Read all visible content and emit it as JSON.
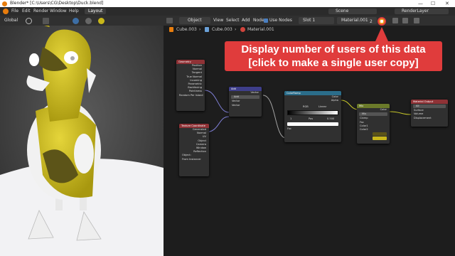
{
  "titlebar": {
    "title": "Blender* [C:\\Users\\CG\\Desktop\\Duck.blend]",
    "min": "—",
    "max": "☐",
    "close": "✕"
  },
  "menubar": {
    "items": [
      "File",
      "Edit",
      "Render",
      "Window",
      "Help"
    ],
    "workspace_tab": "Layout",
    "scene_label": "Scene",
    "render_layer_label": "RenderLayer"
  },
  "viewport_header": {
    "orientation": "Global"
  },
  "node_editor_header": {
    "object_mode": "Object",
    "menus": [
      "View",
      "Select",
      "Add",
      "Node"
    ],
    "use_nodes_label": "Use Nodes",
    "slot": "Slot 1",
    "material": "Material.001",
    "user_count": "2"
  },
  "breadcrumb": {
    "items": [
      "Cube.003",
      "Cube.003",
      "Material.001"
    ]
  },
  "nodes": {
    "geometry": {
      "title": "Geometry",
      "outputs": [
        "Position",
        "Normal",
        "Tangent",
        "True Normal",
        "Incoming",
        "Parametric",
        "Backfacing",
        "Pointiness",
        "Random Per Island"
      ]
    },
    "texcoord": {
      "title": "Texture Coordinate",
      "outputs": [
        "Generated",
        "Normal",
        "UV",
        "Object",
        "Camera",
        "Window",
        "Reflection"
      ],
      "object_label": "Object:",
      "from_instancer": "From Instancer"
    },
    "add": {
      "title": "Add",
      "output": "Vector",
      "mode": "Add",
      "inputs": [
        "Vector",
        "Vector"
      ]
    },
    "colorramp": {
      "title": "ColorRamp",
      "outputs": [
        "Color",
        "Alpha"
      ],
      "color_mode": "RGB",
      "interpolation": "Linear",
      "stop_index": "1",
      "pos_label": "Pos",
      "pos_value": "0.500",
      "input": "Fac"
    },
    "mix": {
      "title": "Mix",
      "output": "Color",
      "blend": "Mix",
      "clamp": "Clamp",
      "inputs": [
        "Fac",
        "Color1",
        "Color2"
      ]
    },
    "output": {
      "title": "Material Output",
      "target": "All",
      "inputs": [
        "Surface",
        "Volume",
        "Displacement"
      ]
    }
  },
  "callout": {
    "line1": "Display number of users of this data",
    "line2": "[click to make a single user copy]"
  },
  "colors": {
    "callout": "#e03c3c",
    "duck": "#c9b71a",
    "geometry_header": "#8f3236",
    "vector_header": "#3e3e8a",
    "converter_header": "#2b6d8a",
    "mix_header": "#6b7a2a",
    "output_header": "#8f3236"
  }
}
